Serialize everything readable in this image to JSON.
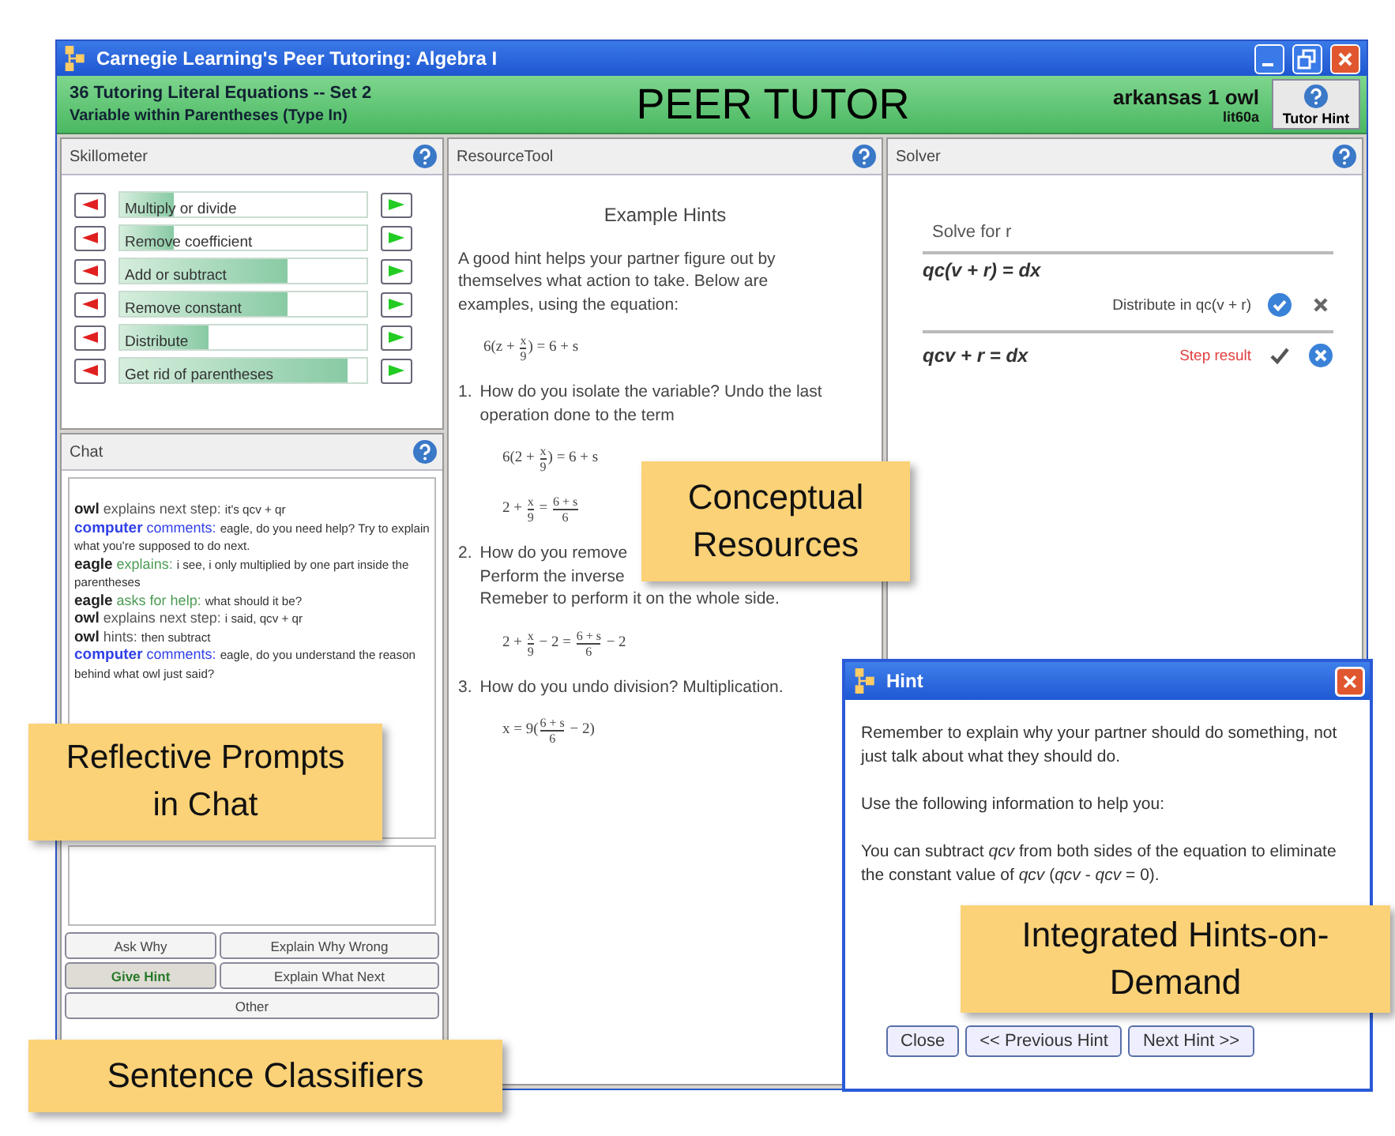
{
  "window": {
    "title": "Carnegie Learning's Peer Tutoring: Algebra I"
  },
  "header": {
    "unit": "36  Tutoring Literal Equations -- Set 2",
    "section": "Variable within Parentheses (Type In)",
    "app_title": "PEER TUTOR",
    "user": "arkansas 1 owl",
    "user_id": "lit60a",
    "tutor_hint_button": "Tutor Hint"
  },
  "skillometer": {
    "title": "Skillometer",
    "skills": [
      {
        "name": "Multiply or divide",
        "level": 0.22
      },
      {
        "name": "Remove coefficient",
        "level": 0.22
      },
      {
        "name": "Add or subtract",
        "level": 0.68
      },
      {
        "name": "Remove constant",
        "level": 0.68
      },
      {
        "name": "Distribute",
        "level": 0.36
      },
      {
        "name": "Get rid of parentheses",
        "level": 0.92
      }
    ]
  },
  "chat": {
    "title": "Chat",
    "messages": [
      {
        "kind": "tutor",
        "speaker": "owl",
        "action": "explains next step:",
        "text": "it's qcv + qr"
      },
      {
        "kind": "computer",
        "speaker": "computer",
        "action": "comments:",
        "text": "eagle, do you need help? Try to explain what you're supposed to do next."
      },
      {
        "kind": "tutee",
        "speaker": "eagle",
        "action": "explains:",
        "text": "i see, i only multiplied by one part inside the parentheses"
      },
      {
        "kind": "tutee",
        "speaker": "eagle",
        "action": "asks for help:",
        "text": "what should it be?"
      },
      {
        "kind": "tutor",
        "speaker": "owl",
        "action": "explains next step:",
        "text": "i said, qcv + qr"
      },
      {
        "kind": "tutor",
        "speaker": "owl",
        "action": "hints:",
        "text": "then subtract"
      },
      {
        "kind": "computer",
        "speaker": "computer",
        "action": "comments:",
        "text": "eagle, do you understand the reason behind what owl just said?"
      }
    ],
    "classifiers": [
      {
        "label": "Ask Why",
        "selected": false
      },
      {
        "label": "Explain Why Wrong",
        "selected": false
      },
      {
        "label": "Give Hint",
        "selected": true
      },
      {
        "label": "Explain What Next",
        "selected": false
      },
      {
        "label": "Other",
        "selected": false
      }
    ]
  },
  "resource_tool": {
    "title": "ResourceTool",
    "blocks": [
      {
        "kind": "heading",
        "text": "Example Hints"
      },
      {
        "kind": "para",
        "text": "A good hint helps your partner figure out by themselves what action to take. Below are examples, using the equation:"
      },
      {
        "kind": "math",
        "parts": [
          {
            "kind": "t",
            "text": "6(z + "
          },
          {
            "kind": "frac",
            "num": "x",
            "den": "9"
          },
          {
            "kind": "t",
            "text": ") = 6 + s"
          }
        ]
      },
      {
        "kind": "item",
        "number": "1.",
        "lines": [
          "How do you isolate the variable? Undo the last",
          "operation done to the term"
        ]
      },
      {
        "kind": "math",
        "parts": [
          {
            "kind": "t",
            "text": "6(2 + "
          },
          {
            "kind": "frac",
            "num": "x",
            "den": "9"
          },
          {
            "kind": "t",
            "text": ") = 6 + s"
          }
        ]
      },
      {
        "kind": "math",
        "parts": [
          {
            "kind": "t",
            "text": "2 + "
          },
          {
            "kind": "frac",
            "num": "x",
            "den": "9"
          },
          {
            "kind": "t",
            "text": " = "
          },
          {
            "kind": "frac",
            "num": "6 + s",
            "den": "6"
          }
        ]
      },
      {
        "kind": "item",
        "number": "2.",
        "lines": [
          "How do you remove",
          "Perform the inverse",
          "Remeber to perform it on the whole side."
        ]
      },
      {
        "kind": "math",
        "parts": [
          {
            "kind": "t",
            "text": "2 + "
          },
          {
            "kind": "frac",
            "num": "x",
            "den": "9"
          },
          {
            "kind": "t",
            "text": " − 2 = "
          },
          {
            "kind": "frac",
            "num": "6 + s",
            "den": "6"
          },
          {
            "kind": "t",
            "text": " − 2"
          }
        ]
      },
      {
        "kind": "item",
        "number": "3.",
        "lines": [
          "How do you undo division? Multiplication."
        ]
      },
      {
        "kind": "math",
        "parts": [
          {
            "kind": "t",
            "text": "x = 9("
          },
          {
            "kind": "frac",
            "num": "6 + s",
            "den": "6"
          },
          {
            "kind": "t",
            "text": " − 2)"
          }
        ]
      }
    ]
  },
  "solver": {
    "title": "Solver",
    "prompt": "Solve for r",
    "steps": [
      {
        "equation": "qc(v + r)  =  dx",
        "action": "Distribute in qc(v + r)",
        "checked": true,
        "flagged": false
      },
      {
        "equation": "qcv + r  =  dx",
        "action": "Step result",
        "checked": false,
        "flagged": true
      }
    ]
  },
  "hint_dialog": {
    "title": "Hint",
    "paragraphs": [
      "Remember to explain why your partner should do something, not just talk about what they should do.",
      "Use the following information to help you:",
      "You can subtract *qcv*  from both sides of the equation to eliminate the constant value of *qcv*  (*qcv* - *qcv* = 0)."
    ],
    "buttons": [
      "Close",
      "<< Previous Hint",
      "Next Hint >>"
    ]
  },
  "callouts": [
    {
      "kind": "chat",
      "text": "Reflective Prompts in Chat"
    },
    {
      "kind": "resources",
      "text": "Conceptual Resources"
    },
    {
      "kind": "hints",
      "text": "Integrated Hints-on-Demand"
    },
    {
      "kind": "classifiers",
      "text": "Sentence Classifiers"
    }
  ]
}
